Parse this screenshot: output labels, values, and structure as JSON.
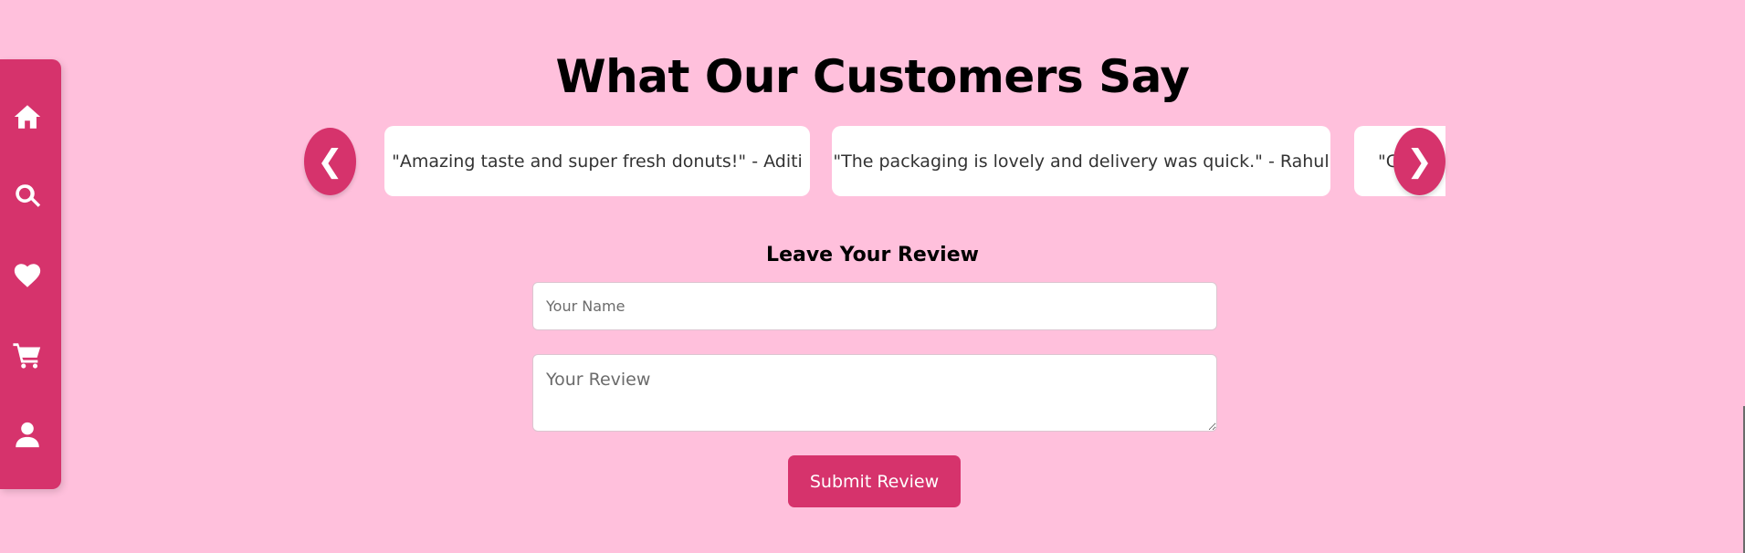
{
  "heading": "What Our Customers Say",
  "sidebar": {
    "items": [
      {
        "name": "home",
        "icon": "home-icon"
      },
      {
        "name": "search",
        "icon": "search-icon"
      },
      {
        "name": "favorites",
        "icon": "heart-icon"
      },
      {
        "name": "cart",
        "icon": "cart-icon"
      },
      {
        "name": "profile",
        "icon": "user-icon"
      }
    ]
  },
  "carousel": {
    "prev_label": "❮",
    "next_label": "❯",
    "testimonials": [
      "\"Amazing taste and super fresh donuts!\" - Aditi",
      "\"The packaging is lovely and delivery was quick.\" - Rahul",
      "\"G"
    ]
  },
  "review_form": {
    "title": "Leave Your Review",
    "name_placeholder": "Your Name",
    "review_placeholder": "Your Review",
    "submit_label": "Submit Review"
  },
  "colors": {
    "background": "#ffc0dc",
    "accent": "#d6336c",
    "card": "#ffffff"
  }
}
